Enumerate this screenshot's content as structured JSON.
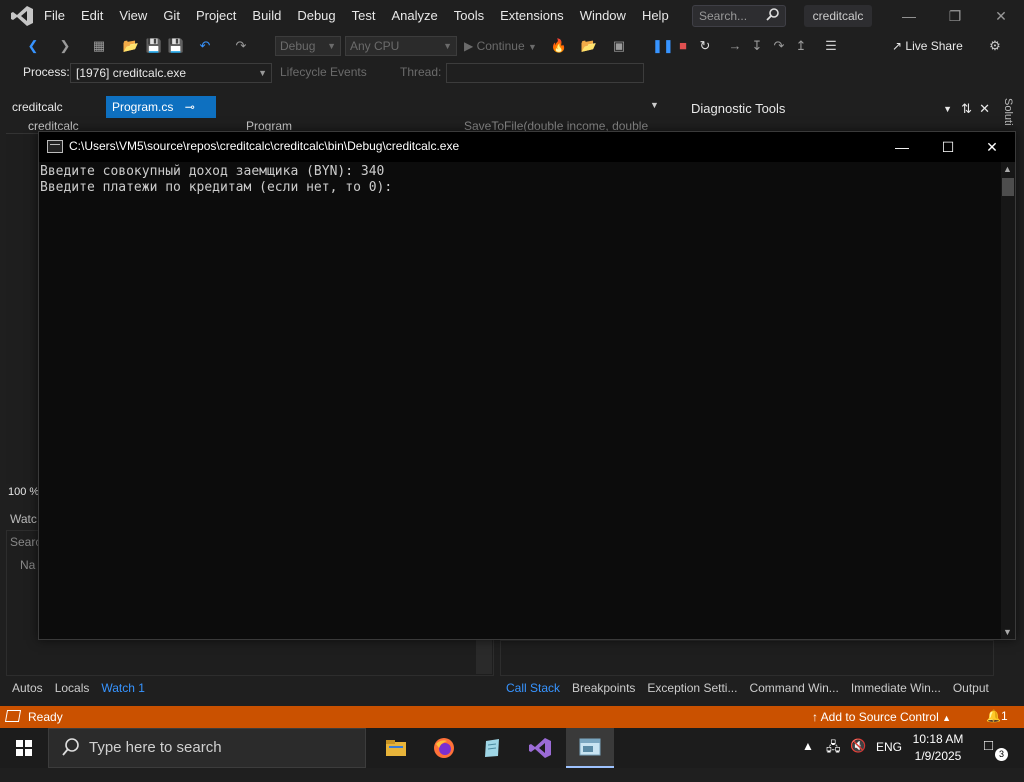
{
  "menubar": {
    "items": [
      "File",
      "Edit",
      "View",
      "Git",
      "Project",
      "Build",
      "Debug",
      "Test",
      "Analyze",
      "Tools",
      "Extensions",
      "Window",
      "Help"
    ],
    "search_placeholder": "Search...",
    "solution_name": "creditcalc"
  },
  "toolbar": {
    "config": "Debug",
    "platform": "Any CPU",
    "continue_label": "Continue",
    "live_share": "Live Share"
  },
  "processbar": {
    "process_label": "Process:",
    "process_value": "[1976] creditcalc.exe",
    "lifecycle_label": "Lifecycle Events",
    "thread_label": "Thread:"
  },
  "doc_tabs": {
    "project_tab": "creditcalc",
    "file_tab": "Program.cs",
    "pin_glyph": "⊸",
    "nav_project": "creditcalc",
    "nav_class": "Program",
    "nav_member": "SaveToFile(double income, double"
  },
  "diagnostics": {
    "title": "Diagnostic Tools",
    "solution_tab": "Soluti"
  },
  "editor": {
    "zoom": "100 %"
  },
  "watch": {
    "title": "Watc",
    "search": "Searc",
    "name_col": "Na"
  },
  "bottom_tabs": {
    "left": [
      {
        "label": "Autos",
        "active": false
      },
      {
        "label": "Locals",
        "active": false
      },
      {
        "label": "Watch 1",
        "active": true
      }
    ],
    "right": [
      {
        "label": "Call Stack",
        "active": true
      },
      {
        "label": "Breakpoints",
        "active": false
      },
      {
        "label": "Exception Setti...",
        "active": false
      },
      {
        "label": "Command Win...",
        "active": false
      },
      {
        "label": "Immediate Win...",
        "active": false
      },
      {
        "label": "Output",
        "active": false
      }
    ]
  },
  "statusbar": {
    "status": "Ready",
    "source_control": "Add to Source Control",
    "notifications": "1",
    "color": "#ca5100"
  },
  "console": {
    "title": "C:\\Users\\VM5\\source\\repos\\creditcalc\\creditcalc\\bin\\Debug\\creditcalc.exe",
    "lines": [
      "Введите совокупный доход заемщика (BYN): 340",
      "Введите платежи по кредитам (если нет, то 0):"
    ]
  },
  "taskbar": {
    "search_placeholder": "Type here to search",
    "language": "ENG",
    "time": "10:18 AM",
    "date": "1/9/2025",
    "notification_count": "3",
    "apps": [
      "file-explorer-icon",
      "firefox-icon",
      "notepad-icon",
      "visual-studio-icon",
      "console-app-icon"
    ]
  }
}
